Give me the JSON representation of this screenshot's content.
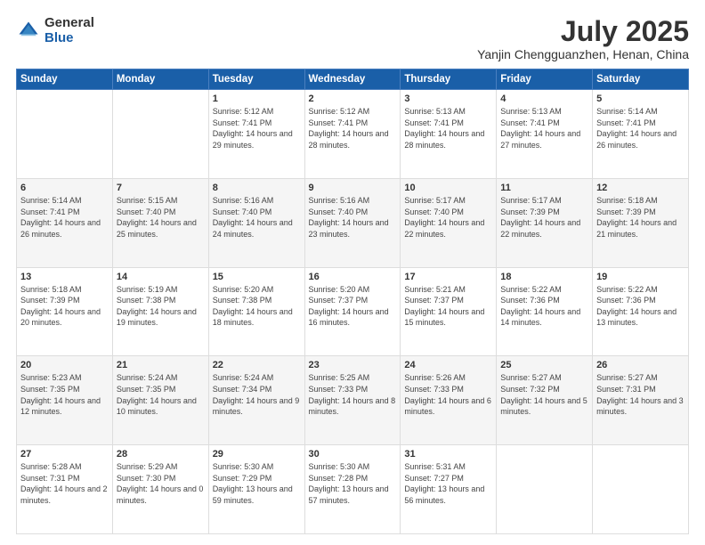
{
  "header": {
    "logo_general": "General",
    "logo_blue": "Blue",
    "month_year": "July 2025",
    "location": "Yanjin Chengguanzhen, Henan, China"
  },
  "days_of_week": [
    "Sunday",
    "Monday",
    "Tuesday",
    "Wednesday",
    "Thursday",
    "Friday",
    "Saturday"
  ],
  "weeks": [
    [
      {
        "day": "",
        "info": ""
      },
      {
        "day": "",
        "info": ""
      },
      {
        "day": "1",
        "info": "Sunrise: 5:12 AM\nSunset: 7:41 PM\nDaylight: 14 hours and 29 minutes."
      },
      {
        "day": "2",
        "info": "Sunrise: 5:12 AM\nSunset: 7:41 PM\nDaylight: 14 hours and 28 minutes."
      },
      {
        "day": "3",
        "info": "Sunrise: 5:13 AM\nSunset: 7:41 PM\nDaylight: 14 hours and 28 minutes."
      },
      {
        "day": "4",
        "info": "Sunrise: 5:13 AM\nSunset: 7:41 PM\nDaylight: 14 hours and 27 minutes."
      },
      {
        "day": "5",
        "info": "Sunrise: 5:14 AM\nSunset: 7:41 PM\nDaylight: 14 hours and 26 minutes."
      }
    ],
    [
      {
        "day": "6",
        "info": "Sunrise: 5:14 AM\nSunset: 7:41 PM\nDaylight: 14 hours and 26 minutes."
      },
      {
        "day": "7",
        "info": "Sunrise: 5:15 AM\nSunset: 7:40 PM\nDaylight: 14 hours and 25 minutes."
      },
      {
        "day": "8",
        "info": "Sunrise: 5:16 AM\nSunset: 7:40 PM\nDaylight: 14 hours and 24 minutes."
      },
      {
        "day": "9",
        "info": "Sunrise: 5:16 AM\nSunset: 7:40 PM\nDaylight: 14 hours and 23 minutes."
      },
      {
        "day": "10",
        "info": "Sunrise: 5:17 AM\nSunset: 7:40 PM\nDaylight: 14 hours and 22 minutes."
      },
      {
        "day": "11",
        "info": "Sunrise: 5:17 AM\nSunset: 7:39 PM\nDaylight: 14 hours and 22 minutes."
      },
      {
        "day": "12",
        "info": "Sunrise: 5:18 AM\nSunset: 7:39 PM\nDaylight: 14 hours and 21 minutes."
      }
    ],
    [
      {
        "day": "13",
        "info": "Sunrise: 5:18 AM\nSunset: 7:39 PM\nDaylight: 14 hours and 20 minutes."
      },
      {
        "day": "14",
        "info": "Sunrise: 5:19 AM\nSunset: 7:38 PM\nDaylight: 14 hours and 19 minutes."
      },
      {
        "day": "15",
        "info": "Sunrise: 5:20 AM\nSunset: 7:38 PM\nDaylight: 14 hours and 18 minutes."
      },
      {
        "day": "16",
        "info": "Sunrise: 5:20 AM\nSunset: 7:37 PM\nDaylight: 14 hours and 16 minutes."
      },
      {
        "day": "17",
        "info": "Sunrise: 5:21 AM\nSunset: 7:37 PM\nDaylight: 14 hours and 15 minutes."
      },
      {
        "day": "18",
        "info": "Sunrise: 5:22 AM\nSunset: 7:36 PM\nDaylight: 14 hours and 14 minutes."
      },
      {
        "day": "19",
        "info": "Sunrise: 5:22 AM\nSunset: 7:36 PM\nDaylight: 14 hours and 13 minutes."
      }
    ],
    [
      {
        "day": "20",
        "info": "Sunrise: 5:23 AM\nSunset: 7:35 PM\nDaylight: 14 hours and 12 minutes."
      },
      {
        "day": "21",
        "info": "Sunrise: 5:24 AM\nSunset: 7:35 PM\nDaylight: 14 hours and 10 minutes."
      },
      {
        "day": "22",
        "info": "Sunrise: 5:24 AM\nSunset: 7:34 PM\nDaylight: 14 hours and 9 minutes."
      },
      {
        "day": "23",
        "info": "Sunrise: 5:25 AM\nSunset: 7:33 PM\nDaylight: 14 hours and 8 minutes."
      },
      {
        "day": "24",
        "info": "Sunrise: 5:26 AM\nSunset: 7:33 PM\nDaylight: 14 hours and 6 minutes."
      },
      {
        "day": "25",
        "info": "Sunrise: 5:27 AM\nSunset: 7:32 PM\nDaylight: 14 hours and 5 minutes."
      },
      {
        "day": "26",
        "info": "Sunrise: 5:27 AM\nSunset: 7:31 PM\nDaylight: 14 hours and 3 minutes."
      }
    ],
    [
      {
        "day": "27",
        "info": "Sunrise: 5:28 AM\nSunset: 7:31 PM\nDaylight: 14 hours and 2 minutes."
      },
      {
        "day": "28",
        "info": "Sunrise: 5:29 AM\nSunset: 7:30 PM\nDaylight: 14 hours and 0 minutes."
      },
      {
        "day": "29",
        "info": "Sunrise: 5:30 AM\nSunset: 7:29 PM\nDaylight: 13 hours and 59 minutes."
      },
      {
        "day": "30",
        "info": "Sunrise: 5:30 AM\nSunset: 7:28 PM\nDaylight: 13 hours and 57 minutes."
      },
      {
        "day": "31",
        "info": "Sunrise: 5:31 AM\nSunset: 7:27 PM\nDaylight: 13 hours and 56 minutes."
      },
      {
        "day": "",
        "info": ""
      },
      {
        "day": "",
        "info": ""
      }
    ]
  ]
}
